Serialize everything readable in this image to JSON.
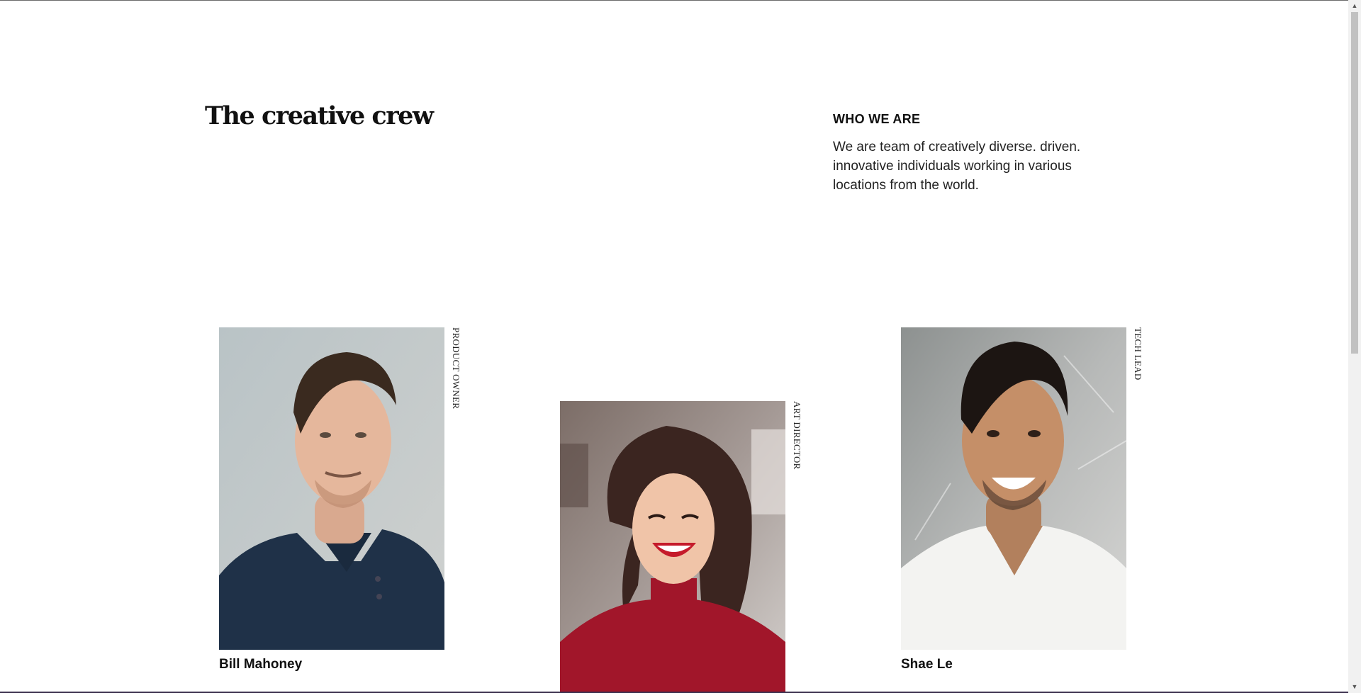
{
  "header": {
    "title": "The creative crew"
  },
  "intro": {
    "heading": "WHO WE ARE",
    "body": "We are team of creatively diverse. driven. innovative individuals working in various locations from the world."
  },
  "team": [
    {
      "name": "Bill Mahoney",
      "role": "PRODUCT OWNER"
    },
    {
      "name": "",
      "role": "ART DIRECTOR"
    },
    {
      "name": "Shae Le",
      "role": "TECH LEAD"
    }
  ],
  "scrollbar": {
    "up_glyph": "▲",
    "down_glyph": "▼"
  }
}
